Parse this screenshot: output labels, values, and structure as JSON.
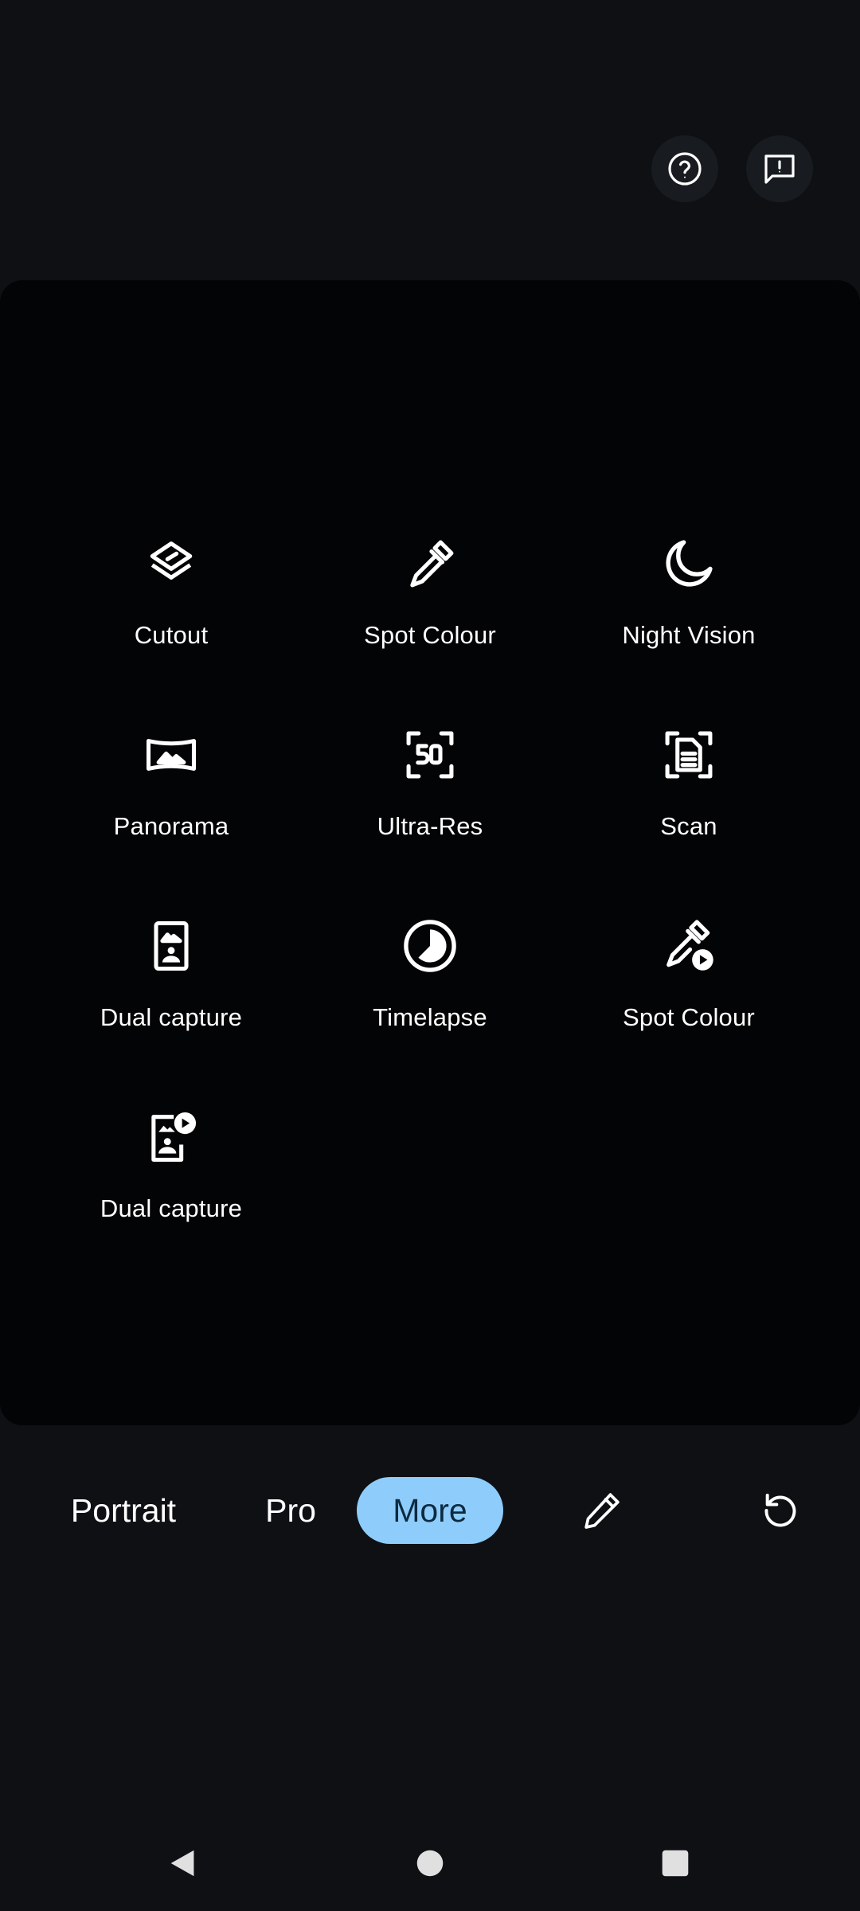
{
  "top_actions": {
    "help_icon": "help-circle-icon",
    "feedback_icon": "feedback-icon"
  },
  "modes": [
    {
      "label": "Cutout",
      "icon": "cutout-layers-icon"
    },
    {
      "label": "Spot Colour",
      "icon": "eyedropper-icon"
    },
    {
      "label": "Night Vision",
      "icon": "crescent-moon-icon"
    },
    {
      "label": "Panorama",
      "icon": "panorama-icon"
    },
    {
      "label": "Ultra-Res",
      "icon": "ultra-res-50-icon"
    },
    {
      "label": "Scan",
      "icon": "document-scan-icon"
    },
    {
      "label": "Dual capture",
      "icon": "dual-capture-photo-icon"
    },
    {
      "label": "Timelapse",
      "icon": "timelapse-icon"
    },
    {
      "label": "Spot Colour",
      "icon": "eyedropper-video-icon"
    },
    {
      "label": "Dual capture",
      "icon": "dual-capture-video-icon"
    }
  ],
  "mode_bar": {
    "tabs": [
      {
        "label": "Portrait",
        "selected": false
      },
      {
        "label": "Pro",
        "selected": false
      },
      {
        "label": "More",
        "selected": true
      }
    ],
    "edit_icon": "pencil-icon",
    "reset_icon": "reset-rotate-icon",
    "selected_color": "#8ecdfb"
  },
  "nav_bar": {
    "back_icon": "triangle-back-icon",
    "home_icon": "circle-home-icon",
    "recents_icon": "square-recents-icon"
  }
}
